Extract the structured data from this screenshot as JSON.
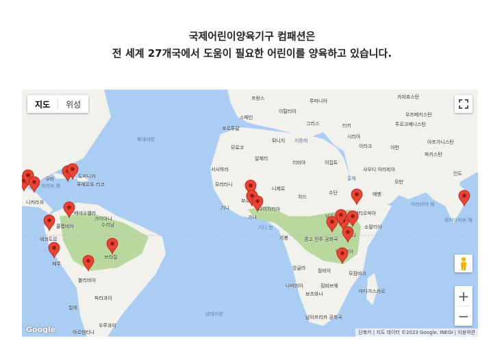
{
  "heading": {
    "line1": "국제어린이양육기구 컴패션은",
    "line2": "전 세계 27개국에서 도움이 필요한 어린이를 양육하고 있습니다."
  },
  "map": {
    "type_controls": {
      "map": "지도",
      "satellite": "위성"
    },
    "zoom_in": "+",
    "zoom_out": "−",
    "logo": "Google",
    "attribution": "단축키 | 지도 데이터 ©2023 Google, INEGI | 이용약관",
    "colors": {
      "marker": "#ea4335",
      "water": "#a9cdf3",
      "land": "#f2f1ec",
      "forest": "#b9d89e"
    },
    "labels": {
      "france": "프랑스",
      "romania": "루마니아",
      "spain": "스페인",
      "italy": "이탈리아",
      "portugal": "포르투갈",
      "greece": "그리스",
      "turkey": "터키",
      "tunisia": "튀니지",
      "syria": "시리아",
      "iraq": "이라크",
      "iran": "이란",
      "morocco": "모로코",
      "algeria": "알제리",
      "libya": "리비아",
      "egypt": "이집트",
      "western_sahara": "서사하라",
      "mauritania": "모리타니",
      "mali": "말리",
      "niger": "니제르",
      "chad": "차드",
      "sudan": "수단",
      "saudi_arabia": "사우디 아라비아",
      "oman": "오만",
      "yemen": "예멘",
      "ethiopia": "에티오피아",
      "somalia": "소말리아",
      "kenya": "케냐",
      "drc": "콩고 민주 공화국",
      "gabon": "가봉",
      "tanzania": "탄자니아",
      "angola": "앙골라",
      "zambia": "잠비아",
      "mozambique": "모잠비크",
      "namibia": "나미비아",
      "zimbabwe": "짐바브웨",
      "botswana": "보츠와나",
      "madagascar": "마다가스카르",
      "south_africa": "남아프리카 공화국",
      "south_sudan": "남수단",
      "nigeria": "나이지리아",
      "ghana": "가나",
      "guinea": "기니",
      "burkina": "부르키나",
      "kazakhstan": "카자흐스탄",
      "uzbekistan": "우즈베키스탄",
      "turkmenistan": "투르크메니스탄",
      "afghanistan": "아프가니스탄",
      "pakistan": "파키스탄",
      "india": "인도",
      "cuba": "쿠바",
      "dominican": "도미니카",
      "puerto_rico": "푸에르토 리코",
      "venezuela": "베네수엘라",
      "guyana": "가이아나",
      "suriname": "수리남",
      "colombia": "콜롬비아",
      "ecuador": "에콰도르",
      "peru": "페루",
      "brazil": "브라질",
      "bolivia": "볼리비아",
      "paraguay": "파라과이",
      "chile": "칠레",
      "uruguay": "우루과이",
      "argentina": "아르헨티나",
      "nicaragua": "니카라과"
    },
    "seas": {
      "north_atlantic": "북대서양",
      "south_atlantic": "남대서양",
      "arabian_sea": "아라비아 해",
      "mediterranean": "지중해",
      "gulf_of_guinea": "기니 만",
      "caribbean": "카리브 해",
      "red_sea": "홍해",
      "laccadive": "래카다이브 해"
    }
  }
}
